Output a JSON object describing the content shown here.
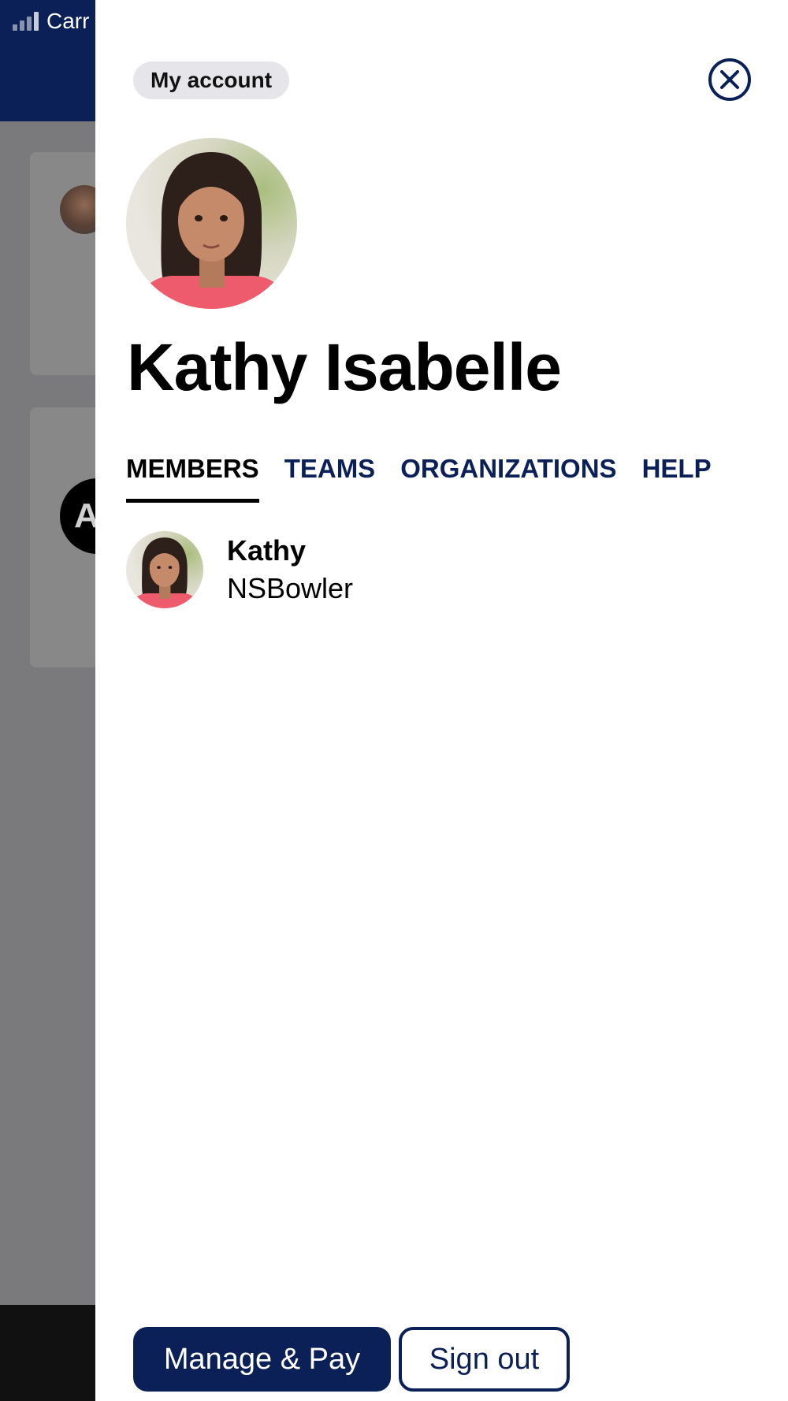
{
  "status_bar": {
    "carrier": "Carr"
  },
  "background": {
    "avatar_letter": "A"
  },
  "panel": {
    "chip_label": "My account",
    "user": {
      "full_name": "Kathy Isabelle"
    },
    "tabs": [
      {
        "label": "MEMBERS",
        "active": true
      },
      {
        "label": "TEAMS",
        "active": false
      },
      {
        "label": "ORGANIZATIONS",
        "active": false
      },
      {
        "label": "HELP",
        "active": false
      }
    ],
    "members": [
      {
        "name": "Kathy",
        "subtitle": "NSBowler"
      }
    ],
    "buttons": {
      "manage_pay": "Manage & Pay",
      "sign_out": "Sign out"
    }
  },
  "colors": {
    "brand_navy": "#0a2057",
    "overlay_gray": "#7a7a7d",
    "chip_bg": "#e6e6ea"
  },
  "icons": {
    "close": "close-circle-icon",
    "signal": "signal-icon"
  }
}
